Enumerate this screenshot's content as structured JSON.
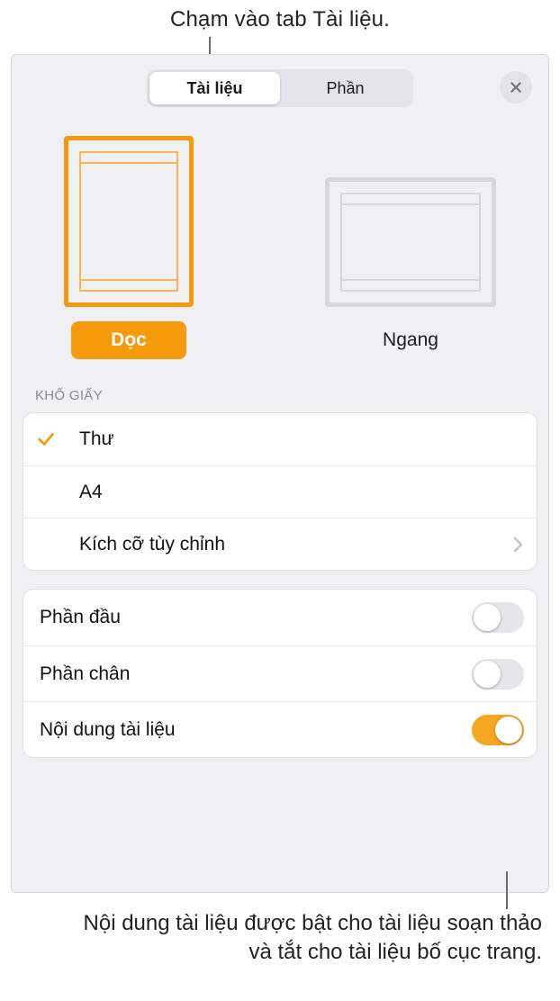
{
  "callouts": {
    "top": "Chạm vào tab Tài liệu.",
    "bottom": "Nội dung tài liệu được bật cho tài liệu soạn thảo và tắt cho tài liệu bố cục trang."
  },
  "segmented": {
    "items": [
      {
        "label": "Tài liệu",
        "selected": true
      },
      {
        "label": "Phần",
        "selected": false
      }
    ]
  },
  "orientation": {
    "portrait": {
      "label": "Dọc",
      "selected": true
    },
    "landscape": {
      "label": "Ngang",
      "selected": false
    }
  },
  "paper": {
    "header": "KHỔ GIẤY",
    "items": [
      {
        "label": "Thư",
        "checked": true,
        "disclosure": false
      },
      {
        "label": "A4",
        "checked": false,
        "disclosure": false
      },
      {
        "label": "Kích cỡ tùy chỉnh",
        "checked": false,
        "disclosure": true
      }
    ]
  },
  "toggles": [
    {
      "label": "Phần đầu",
      "on": false
    },
    {
      "label": "Phần chân",
      "on": false
    },
    {
      "label": "Nội dung tài liệu",
      "on": true
    }
  ],
  "colors": {
    "accent": "#f59a0a"
  }
}
